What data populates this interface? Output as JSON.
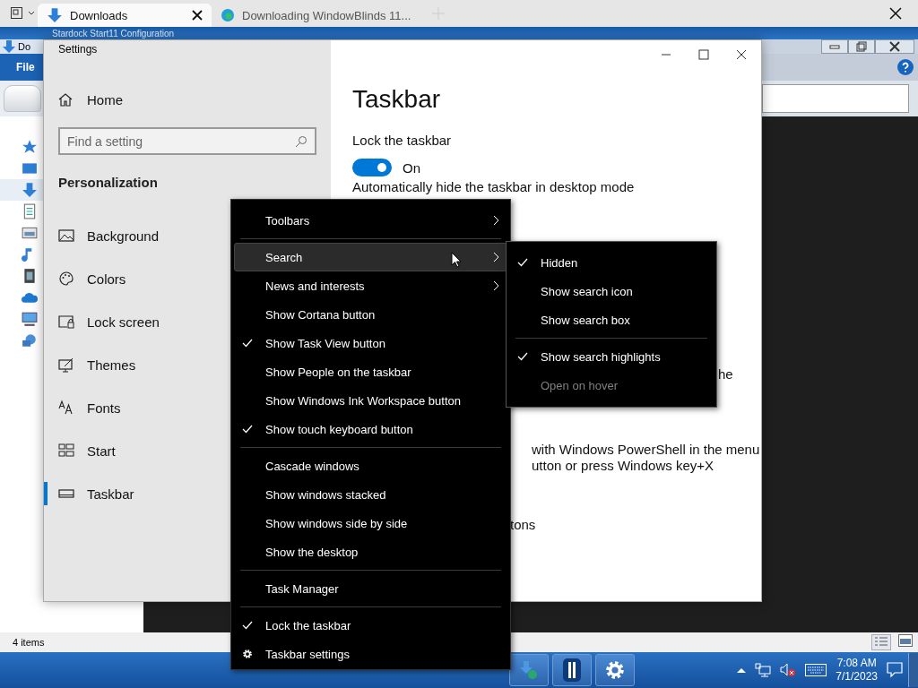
{
  "browser_tabs": [
    {
      "label": "Downloads",
      "selected": true
    },
    {
      "label": "Downloading WindowBlinds 11...",
      "selected": false
    }
  ],
  "explorer": {
    "title": "Stardock Start11 Configuration",
    "address_fragment": "Do",
    "ribbon_tab": "File",
    "status": "4 items"
  },
  "settings": {
    "title": "Settings",
    "home": "Home",
    "search": {
      "placeholder": "Find a setting"
    },
    "section": "Personalization",
    "nav": [
      {
        "label": "Background",
        "selected": false
      },
      {
        "label": "Colors",
        "selected": false
      },
      {
        "label": "Lock screen",
        "selected": false
      },
      {
        "label": "Themes",
        "selected": false
      },
      {
        "label": "Fonts",
        "selected": false
      },
      {
        "label": "Start",
        "selected": false
      },
      {
        "label": "Taskbar",
        "selected": true
      }
    ],
    "page_title": "Taskbar",
    "lock_label": "Lock the taskbar",
    "lock_on": true,
    "lock_state": "On",
    "autohide_label": "Automatically hide the taskbar in desktop mode",
    "fragments": [
      "he",
      "with Windows PowerShell in the menu",
      "utton or press Windows key+X",
      "tons"
    ]
  },
  "context_menu": {
    "groups": [
      [
        {
          "label": "Toolbars",
          "kind": "option",
          "checked": false,
          "submenu": true,
          "selected": false
        }
      ],
      [
        {
          "label": "Search",
          "kind": "option",
          "checked": false,
          "submenu": true,
          "selected": true
        },
        {
          "label": "News and interests",
          "kind": "option",
          "checked": false,
          "submenu": true,
          "selected": false
        },
        {
          "label": "Show Cortana button",
          "kind": "option",
          "checked": false,
          "submenu": false,
          "selected": false
        },
        {
          "label": "Show Task View button",
          "kind": "option",
          "checked": true,
          "submenu": false,
          "selected": false
        },
        {
          "label": "Show People on the taskbar",
          "kind": "option",
          "checked": false,
          "submenu": false,
          "selected": false
        },
        {
          "label": "Show Windows Ink Workspace button",
          "kind": "option",
          "checked": false,
          "submenu": false,
          "selected": false
        },
        {
          "label": "Show touch keyboard button",
          "kind": "option",
          "checked": true,
          "submenu": false,
          "selected": false
        }
      ],
      [
        {
          "label": "Cascade windows",
          "kind": "option",
          "checked": false,
          "submenu": false,
          "selected": false
        },
        {
          "label": "Show windows stacked",
          "kind": "option",
          "checked": false,
          "submenu": false,
          "selected": false
        },
        {
          "label": "Show windows side by side",
          "kind": "option",
          "checked": false,
          "submenu": false,
          "selected": false
        },
        {
          "label": "Show the desktop",
          "kind": "option",
          "checked": false,
          "submenu": false,
          "selected": false
        }
      ],
      [
        {
          "label": "Task Manager",
          "kind": "option",
          "checked": false,
          "submenu": false,
          "selected": false
        }
      ],
      [
        {
          "label": "Lock the taskbar",
          "kind": "option",
          "checked": true,
          "submenu": false,
          "selected": false
        },
        {
          "label": "Taskbar settings",
          "kind": "settings",
          "submenu": false,
          "selected": false
        }
      ]
    ]
  },
  "search_submenu": {
    "groups": [
      [
        {
          "label": "Hidden",
          "checked": true,
          "disabled": false
        },
        {
          "label": "Show search icon",
          "checked": false,
          "disabled": false
        },
        {
          "label": "Show search box",
          "checked": false,
          "disabled": false
        }
      ],
      [
        {
          "label": "Show search highlights",
          "checked": true,
          "disabled": false
        },
        {
          "label": "Open on hover",
          "checked": false,
          "disabled": true
        }
      ]
    ]
  },
  "taskbar": {
    "time": "7:08 AM",
    "date": "7/1/2023"
  }
}
